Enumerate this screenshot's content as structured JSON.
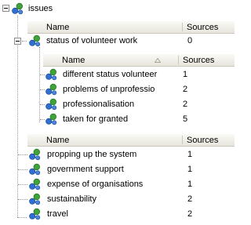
{
  "root": {
    "label": "issues",
    "icon": "node-icon"
  },
  "table1": {
    "columns": {
      "name": "Name",
      "sources": "Sources"
    },
    "rows": [
      {
        "name": "status of volunteer work",
        "sources": "0"
      }
    ]
  },
  "table2": {
    "columns": {
      "name": "Name",
      "sources": "Sources"
    },
    "sort_icon": "sort-indicator-icon",
    "rows": [
      {
        "name": "different status volunteer",
        "sources": "1"
      },
      {
        "name": "problems of unprofessio",
        "sources": "2"
      },
      {
        "name": "professionalisation",
        "sources": "2"
      },
      {
        "name": "taken for granted",
        "sources": "5"
      }
    ]
  },
  "table3": {
    "columns": {
      "name": "Name",
      "sources": "Sources"
    },
    "rows": [
      {
        "name": "propping up the system",
        "sources": "1"
      },
      {
        "name": "government support",
        "sources": "1"
      },
      {
        "name": "expense of organisations",
        "sources": "1"
      },
      {
        "name": "sustainability",
        "sources": "2"
      },
      {
        "name": "travel",
        "sources": "2"
      }
    ]
  },
  "colors": {
    "header_bg": "#ece9d8",
    "node_green": "#3fa33a",
    "node_blue": "#2f6fd1"
  }
}
